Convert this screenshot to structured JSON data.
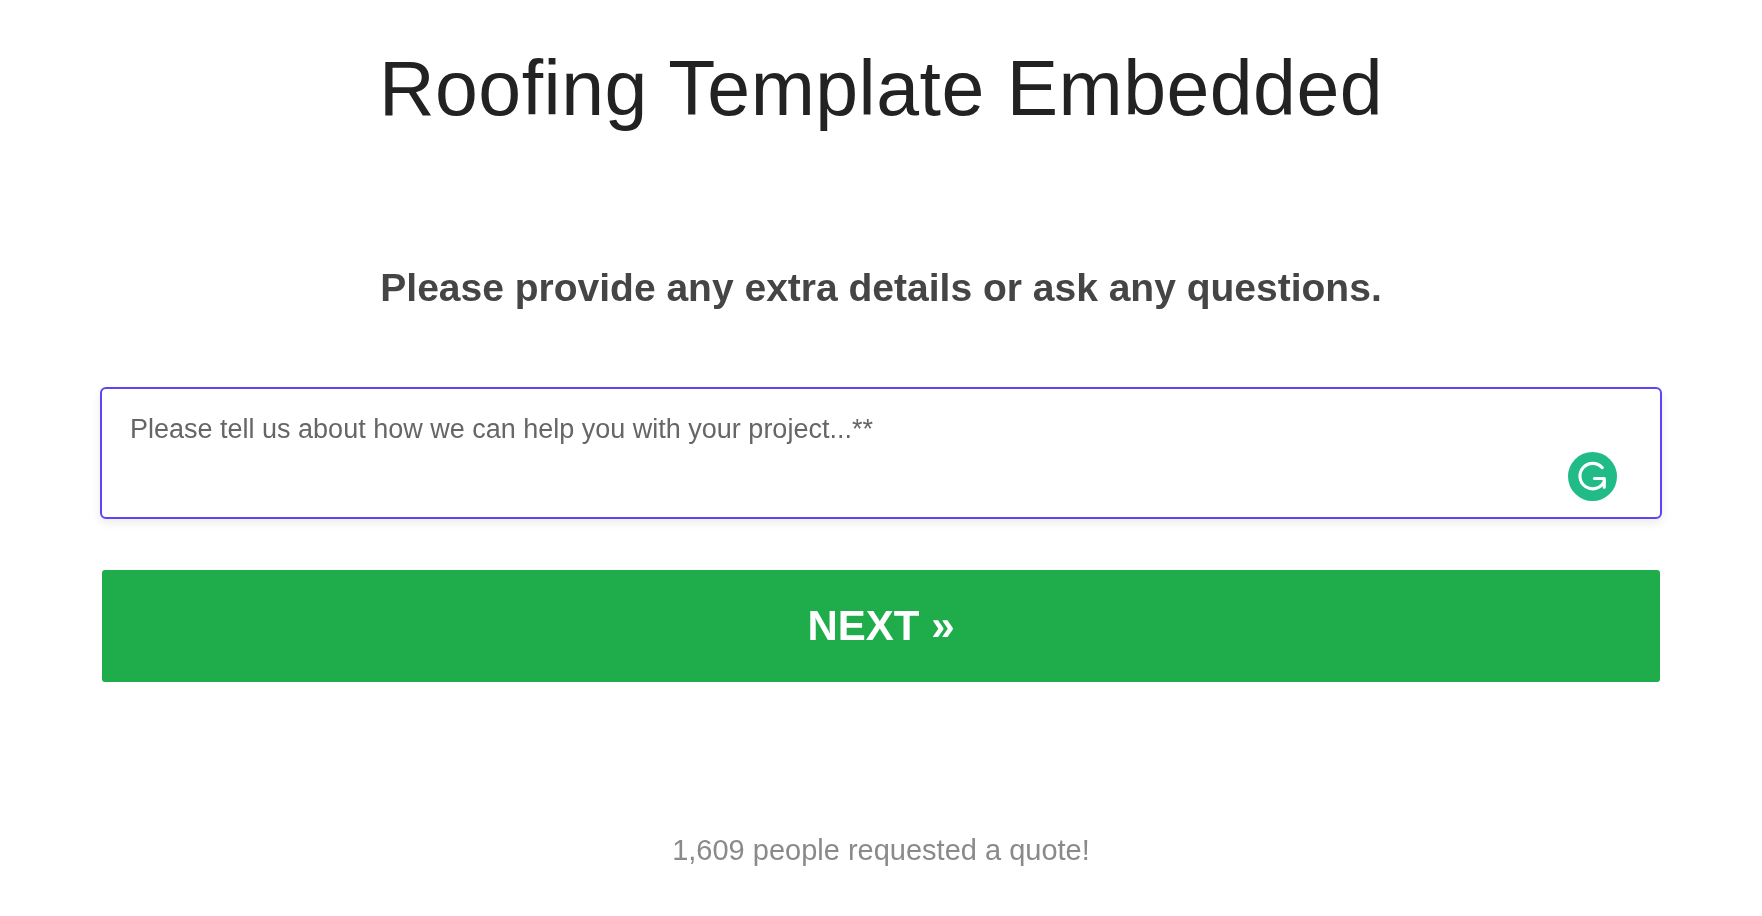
{
  "title": "Roofing Template Embedded",
  "question": "Please provide any extra details or ask any questions.",
  "details_field": {
    "placeholder": "Please tell us about how we can help you with your project...**",
    "focused": true
  },
  "next_button": {
    "label": "NEXT »"
  },
  "footer": {
    "text": "1,609 people requested a quote!"
  }
}
